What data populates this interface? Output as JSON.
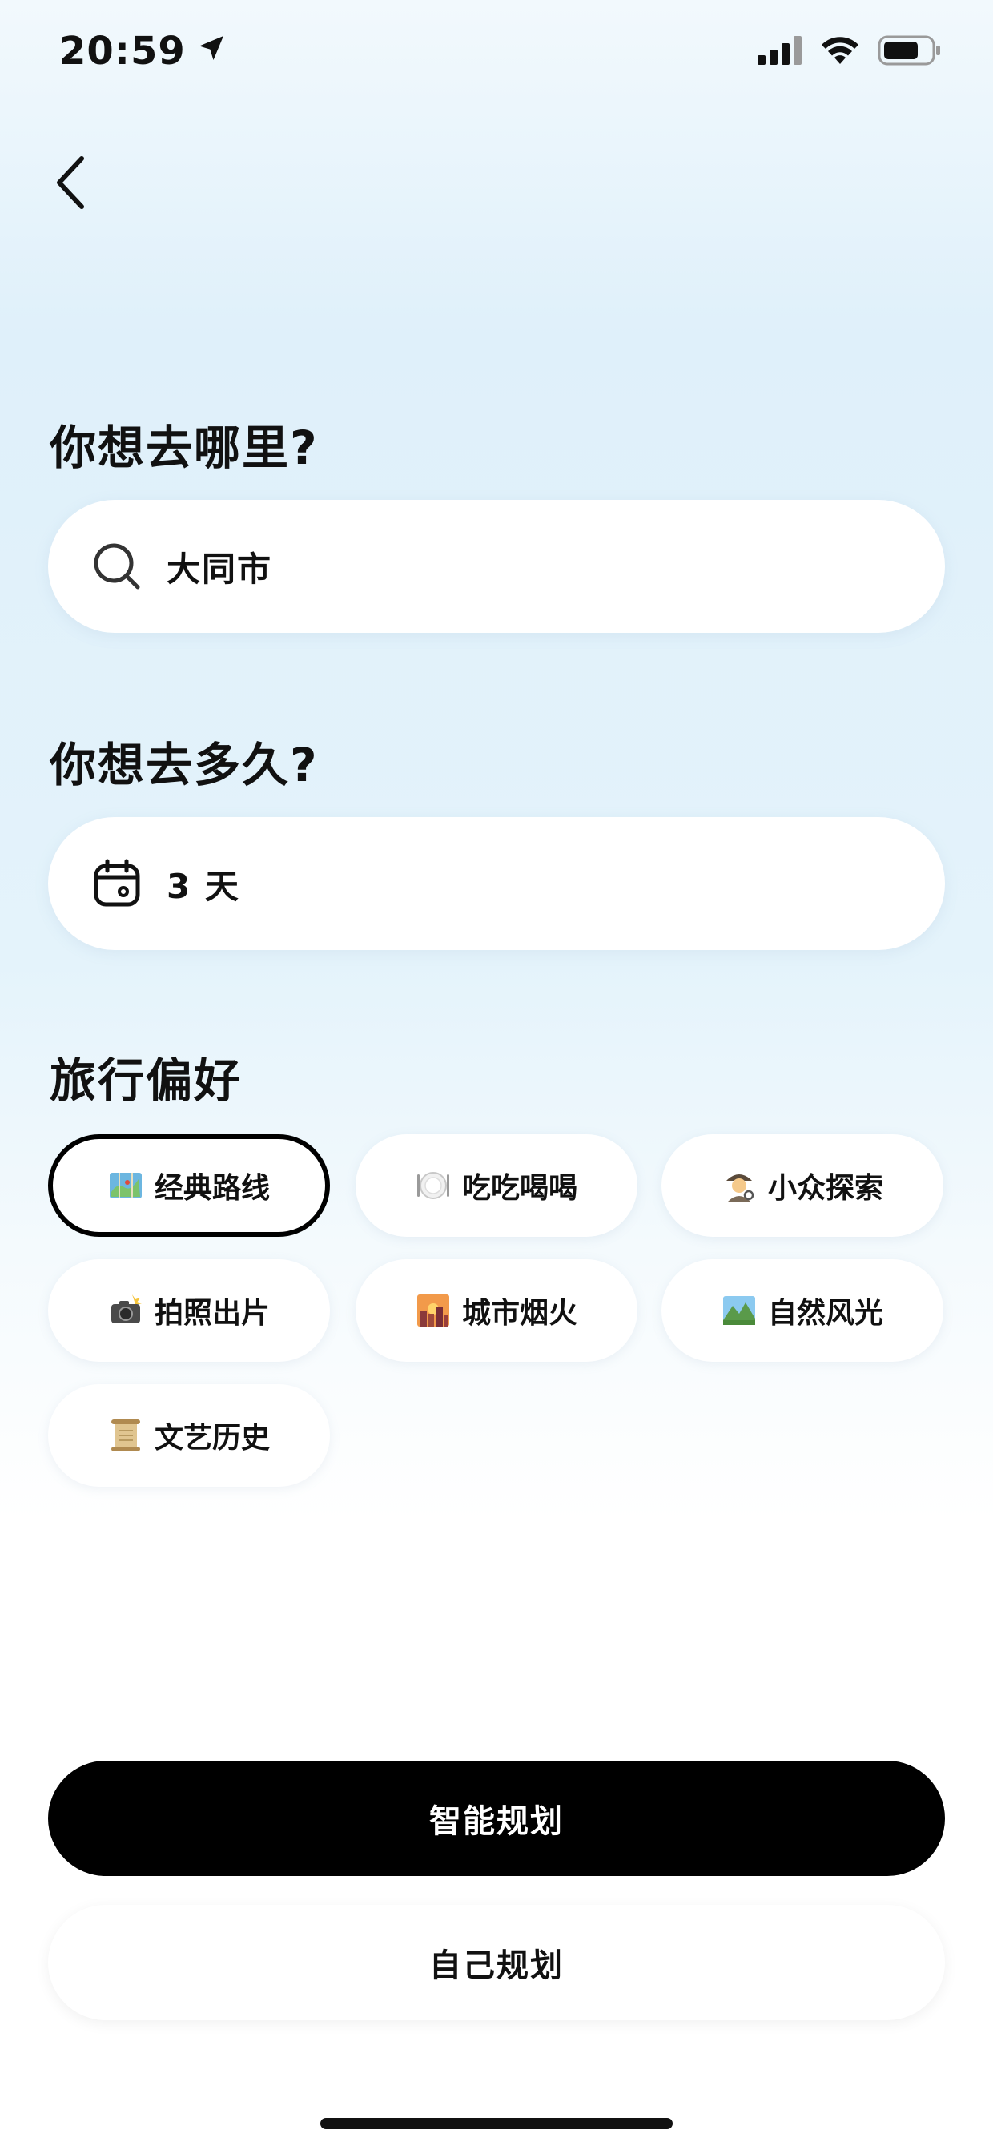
{
  "status_bar": {
    "time": "20:59",
    "icons": [
      "location-arrow-icon",
      "cellular-signal-icon",
      "wifi-icon",
      "battery-icon"
    ]
  },
  "nav": {
    "back_icon": "chevron-left-icon"
  },
  "destination": {
    "title": "你想去哪里?",
    "value": "大同市",
    "icon": "search-icon"
  },
  "duration": {
    "title": "你想去多久?",
    "value": "3 天",
    "icon": "calendar-icon"
  },
  "preferences": {
    "title": "旅行偏好",
    "selected": "经典路线",
    "items": [
      {
        "label": "经典路线",
        "icon": "map-emoji-icon"
      },
      {
        "label": "吃吃喝喝",
        "icon": "plate-emoji-icon"
      },
      {
        "label": "小众探索",
        "icon": "detective-emoji-icon"
      },
      {
        "label": "拍照出片",
        "icon": "camera-flash-emoji-icon"
      },
      {
        "label": "城市烟火",
        "icon": "city-sunset-emoji-icon"
      },
      {
        "label": "自然风光",
        "icon": "landscape-emoji-icon"
      },
      {
        "label": "文艺历史",
        "icon": "scroll-emoji-icon"
      }
    ]
  },
  "actions": {
    "smart_plan": "智能规划",
    "self_plan": "自己规划"
  },
  "colors": {
    "primary_button": "#000000",
    "background_top": "#dff0fa",
    "card": "#ffffff"
  }
}
